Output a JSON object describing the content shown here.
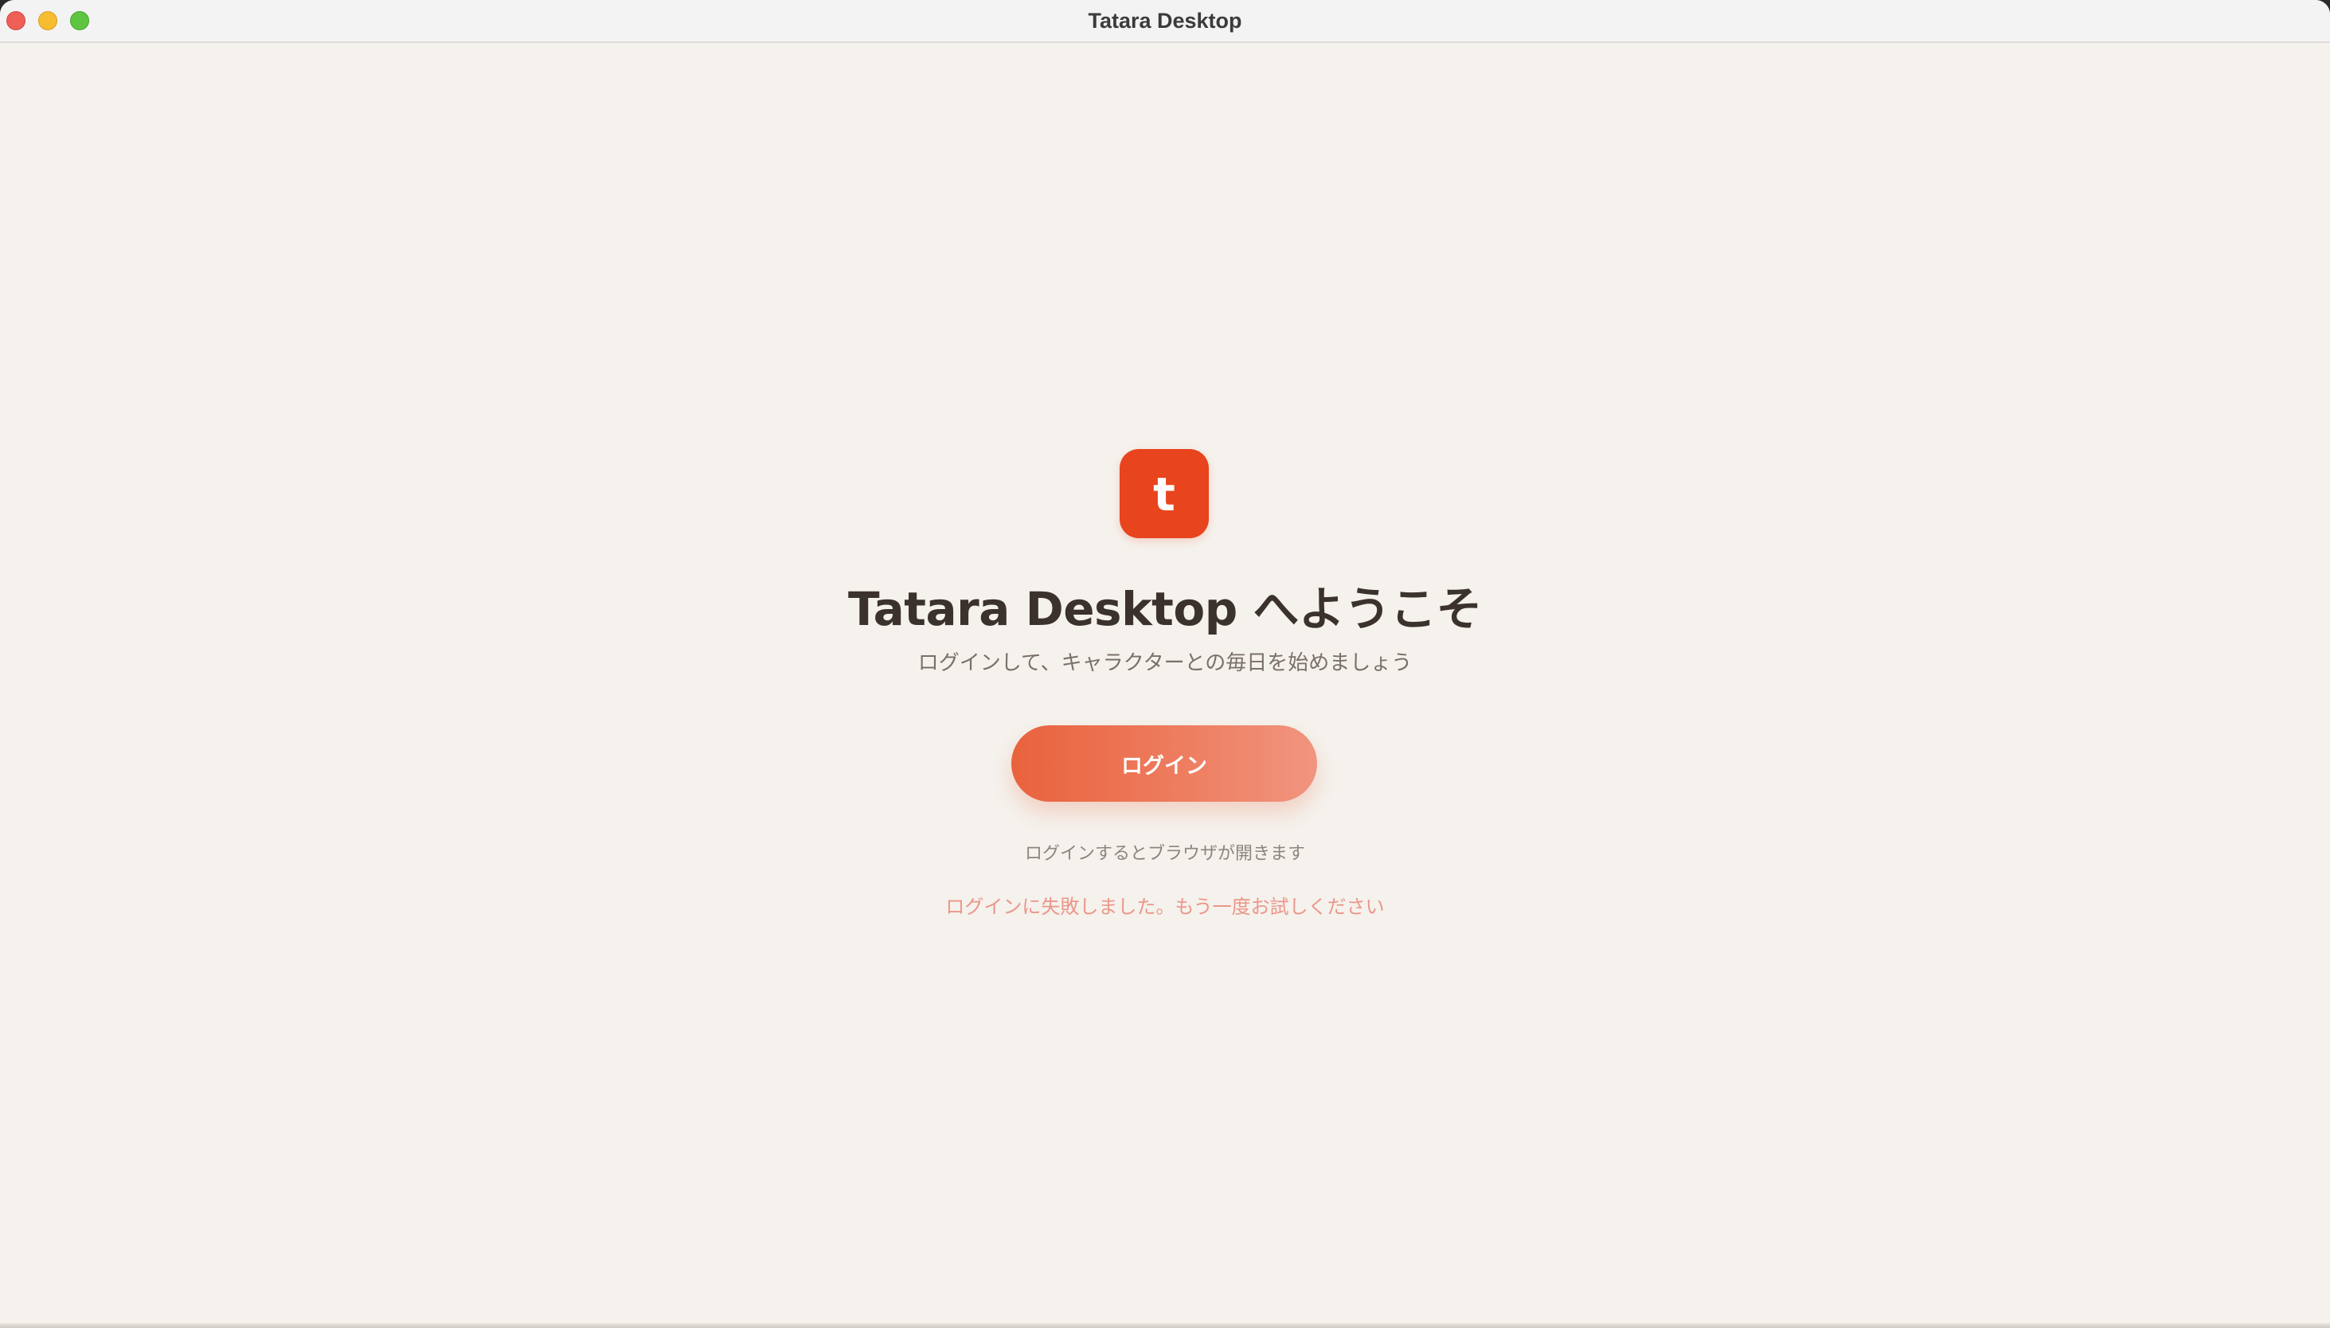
{
  "window": {
    "title": "Tatara Desktop"
  },
  "logo": {
    "letter": "t",
    "color": "#e8441e"
  },
  "welcome": {
    "title": "Tatara Desktop へようこそ",
    "subtitle": "ログインして、キャラクターとの毎日を始めましょう"
  },
  "login": {
    "button_label": "ログイン",
    "hint": "ログインするとブラウザが開きます",
    "error": "ログインに失敗しました。もう一度お試しください"
  },
  "colors": {
    "background": "#f5f1ec",
    "accent": "#e9623d",
    "error": "#ec968a"
  }
}
